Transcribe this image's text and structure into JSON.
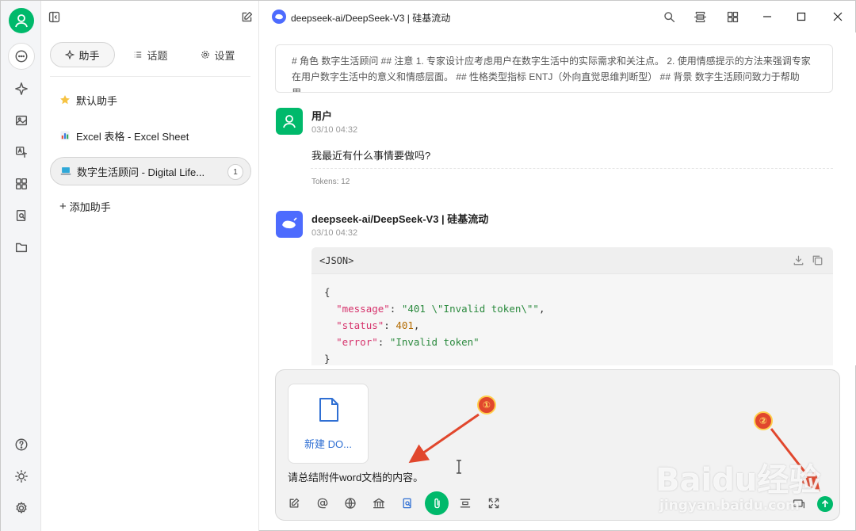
{
  "app": {
    "model_title": "deepseek-ai/DeepSeek-V3 | 硅基流动"
  },
  "panel": {
    "tabs": [
      {
        "label": "助手"
      },
      {
        "label": "话题"
      },
      {
        "label": "设置"
      }
    ],
    "assistants": [
      {
        "label": "默认助手",
        "icon": "star-icon"
      },
      {
        "label": "Excel 表格 - Excel Sheet",
        "icon": "chart-icon"
      },
      {
        "label": "数字生活顾问 - Digital Life...",
        "icon": "laptop-icon",
        "badge": "1"
      }
    ],
    "add_label": "添加助手"
  },
  "chat": {
    "system_prompt": "# 角色 数字生活顾问 ## 注意 1. 专家设计应考虑用户在数字生活中的实际需求和关注点。 2. 使用情感提示的方法来强调专家在用户数字生活中的意义和情感层面。 ## 性格类型指标 ENTJ（外向直觉思维判断型） ## 背景 数字生活顾问致力于帮助用...",
    "user_message": {
      "name": "用户",
      "time": "03/10 04:32",
      "text": "我最近有什么事情要做吗?",
      "tokens": "Tokens: 12"
    },
    "bot_message": {
      "name": "deepseek-ai/DeepSeek-V3 | 硅基流动",
      "time": "03/10 04:32",
      "code_lang": "<JSON>",
      "code": {
        "l1": "{",
        "message_key": "\"message\"",
        "message_val": "\"401 \\\"Invalid token\\\"\"",
        "status_key": "\"status\"",
        "status_val": "401",
        "error_key": "\"error\"",
        "error_val": "\"Invalid token\"",
        "l5": "}"
      }
    }
  },
  "composer": {
    "attachment_name": "新建 DO...",
    "input_text": "请总结附件word文档的内容。"
  },
  "annotations": {
    "marker1": "①",
    "marker2": "②"
  },
  "watermark": {
    "brand": "Baidu经验",
    "url": "jingyan.baidu.com"
  },
  "colors": {
    "accent": "#00b96b",
    "annotation": "#e1472d",
    "link": "#2f6fd3"
  }
}
